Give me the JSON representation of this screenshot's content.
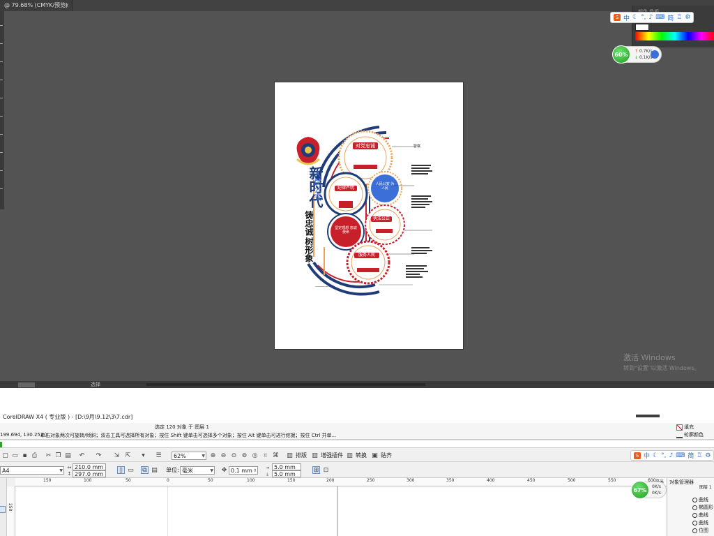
{
  "upper": {
    "doc_tab": "@ 79.68% (CMYK/预览)",
    "close_glyph": "×",
    "status": "选择",
    "activate_title": "激活 Windows",
    "activate_sub": "转到\"设置\"以激活 Windows。",
    "color_panel_tabs": "颜色  色板"
  },
  "artwork": {
    "big_title": "新时代",
    "side_title": "人民公安",
    "slogan1": "铸忠诚",
    "slogan2": "树形象",
    "circles": [
      "对党忠诚",
      "纪律严明",
      "服务人民",
      "执法公正",
      "服务人民"
    ],
    "red_circle_text": "坚定理想 忠诚使命",
    "blue_circle_text": "人民公安 为人民",
    "right_head": "警察"
  },
  "ime": {
    "mode": "中",
    "simp": "简"
  },
  "net_upper": {
    "percent": "60%",
    "up": "0.7K/s",
    "down": "0.1K/s"
  },
  "net_lower": {
    "percent": "67%",
    "up": "0K/s",
    "down": "0K/s"
  },
  "corel": {
    "title": "CorelDRAW X4 ( 专业版 ) - [D:\\9月\\9.12\\3\\7.cdr]",
    "selection": "选定 120 对象 于 图层 1",
    "coords": "199.694, 130.252 )",
    "hint": "单击对象两次可旋转/倾斜；双击工具可选择所有对象；按住 Shift 键单击可选择多个对象；按住 Alt 键单击可进行挖掘；按住 Ctrl 并单...",
    "fill_label": "填充",
    "outline_label": "轮廓颜色",
    "zoom": "62%",
    "paste_label": "排版",
    "effects_label": "增强插件",
    "convert_label": "转换",
    "snap_label": "贴齐",
    "page_size": "A4",
    "width": "210.0 mm",
    "height": "297.0 mm",
    "unit_label": "单位:",
    "unit": "毫米",
    "nudge": "0.1 mm",
    "dup_x": "5.0 mm",
    "dup_y": "5.0 mm",
    "ruler_unit": "毫米",
    "ruler_labels": [
      "150",
      "100",
      "50",
      "0",
      "50",
      "100",
      "150",
      "200",
      "250",
      "300",
      "350",
      "400",
      "450",
      "500",
      "550",
      "600"
    ],
    "vruler_label": "250",
    "obj_manager": "对象管理器",
    "layer": "图层 1",
    "objects": [
      "曲线",
      "椭圆形",
      "曲线",
      "曲线",
      "位图"
    ]
  },
  "colors": {
    "canvas": "#535353",
    "navy": "#1f3c78",
    "red": "#c8202a",
    "orange": "#e9a35b",
    "blue": "#3d6fd8",
    "green": "#2da02d"
  }
}
